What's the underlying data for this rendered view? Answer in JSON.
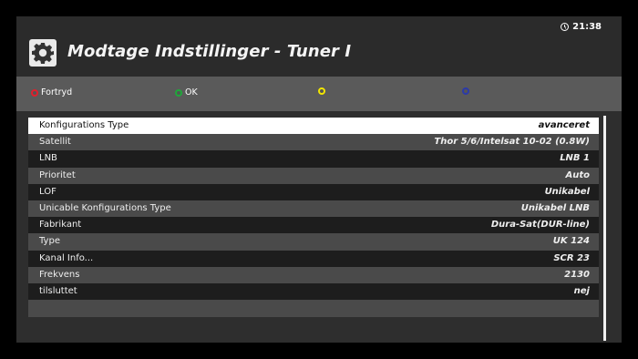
{
  "header": {
    "title": "Modtage Indstillinger - Tuner I",
    "time": "21:38"
  },
  "keys": [
    {
      "label": "Fortryd",
      "color": "#e0202c"
    },
    {
      "label": "OK",
      "color": "#1fa83a"
    },
    {
      "label": "",
      "color": "#f2e600"
    },
    {
      "label": "",
      "color": "#2b3aa8"
    }
  ],
  "settings": [
    {
      "label": "Konfigurations Type",
      "value": "avanceret",
      "selected": true
    },
    {
      "label": "Satellit",
      "value": "Thor 5/6/Intelsat 10-02 (0.8W)"
    },
    {
      "label": "LNB",
      "value": "LNB 1"
    },
    {
      "label": "Prioritet",
      "value": "Auto"
    },
    {
      "label": "LOF",
      "value": "Unikabel"
    },
    {
      "label": "Unicable Konfigurations Type",
      "value": "Unikabel LNB"
    },
    {
      "label": "Fabrikant",
      "value": "Dura-Sat(DUR-line)"
    },
    {
      "label": "Type",
      "value": "UK 124"
    },
    {
      "label": "Kanal Info...",
      "value": "SCR 23"
    },
    {
      "label": "Frekvens",
      "value": "2130"
    },
    {
      "label": "tilsluttet",
      "value": "nej"
    }
  ]
}
